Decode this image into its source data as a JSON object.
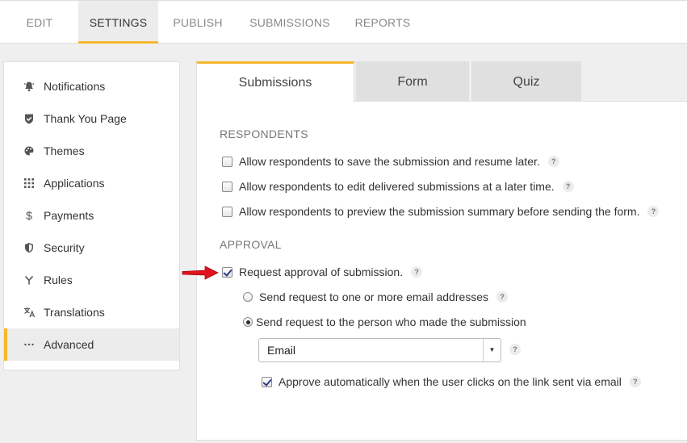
{
  "topnav": {
    "tabs": [
      {
        "label": "EDIT"
      },
      {
        "label": "SETTINGS"
      },
      {
        "label": "PUBLISH"
      },
      {
        "label": "SUBMISSIONS"
      },
      {
        "label": "REPORTS"
      }
    ],
    "active": "SETTINGS"
  },
  "sidebar": {
    "items": [
      {
        "label": "Notifications",
        "icon": "bell-icon"
      },
      {
        "label": "Thank You Page",
        "icon": "shield-check-icon"
      },
      {
        "label": "Themes",
        "icon": "palette-icon"
      },
      {
        "label": "Applications",
        "icon": "grid-icon"
      },
      {
        "label": "Payments",
        "icon": "dollar-icon"
      },
      {
        "label": "Security",
        "icon": "shield-icon"
      },
      {
        "label": "Rules",
        "icon": "fork-icon"
      },
      {
        "label": "Translations",
        "icon": "translate-icon"
      },
      {
        "label": "Advanced",
        "icon": "more-icon"
      }
    ],
    "active": "Advanced"
  },
  "content_tabs": {
    "tabs": [
      {
        "label": "Submissions"
      },
      {
        "label": "Form"
      },
      {
        "label": "Quiz"
      }
    ],
    "active": "Submissions"
  },
  "respondents": {
    "title": "RESPONDENTS",
    "options": [
      {
        "label": "Allow respondents to save the submission and resume later.",
        "checked": false
      },
      {
        "label": "Allow respondents to edit delivered submissions at a later time.",
        "checked": false
      },
      {
        "label": "Allow respondents to preview the submission summary before sending the form.",
        "checked": false
      }
    ]
  },
  "approval": {
    "title": "APPROVAL",
    "request_label": "Request approval of submission.",
    "request_checked": true,
    "radio_email_label": "Send request to one or more email addresses",
    "radio_person_label": "Send request to the person who made the submission",
    "selected_radio": "person",
    "email_select_value": "Email",
    "auto_approve_label": "Approve automatically when the user clicks on the link sent via email",
    "auto_approve_checked": true
  },
  "help_glyph": "?",
  "colors": {
    "accent": "#f5b82e",
    "pointer_arrow": "#e0141e"
  }
}
